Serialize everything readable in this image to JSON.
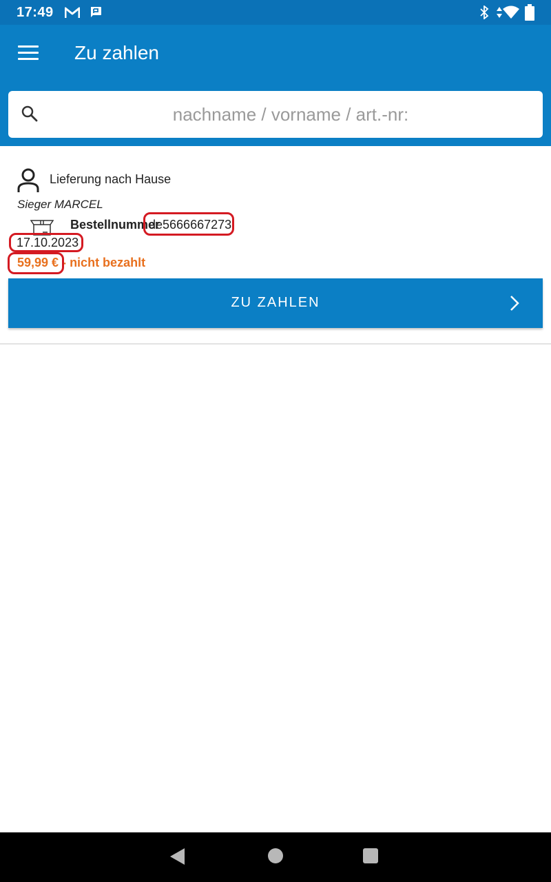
{
  "status_bar": {
    "time": "17:49",
    "icons": [
      "gmail-icon",
      "message-icon",
      "bluetooth-icon",
      "data-arrows-icon",
      "wifi-icon",
      "battery-icon"
    ]
  },
  "app_bar": {
    "title": "Zu zahlen",
    "color": "#0b7fc5"
  },
  "search": {
    "placeholder": "nachname / vorname / art.-nr:",
    "value": ""
  },
  "order": {
    "delivery_type": "Lieferung nach Hause",
    "customer_name": "Sieger MARCEL",
    "order_number_label": "Bestellnummer",
    "order_number": "de5666667273",
    "date": "17.10.2023",
    "amount": "59,99 € -",
    "payment_status": " nicht bezahlt",
    "status_color": "#e8701e",
    "highlight_color": "#d41a22"
  },
  "action": {
    "pay_label": "ZU ZAHLEN"
  },
  "nav_bar": {
    "icons": [
      "back-icon",
      "home-icon",
      "recent-apps-icon"
    ]
  }
}
